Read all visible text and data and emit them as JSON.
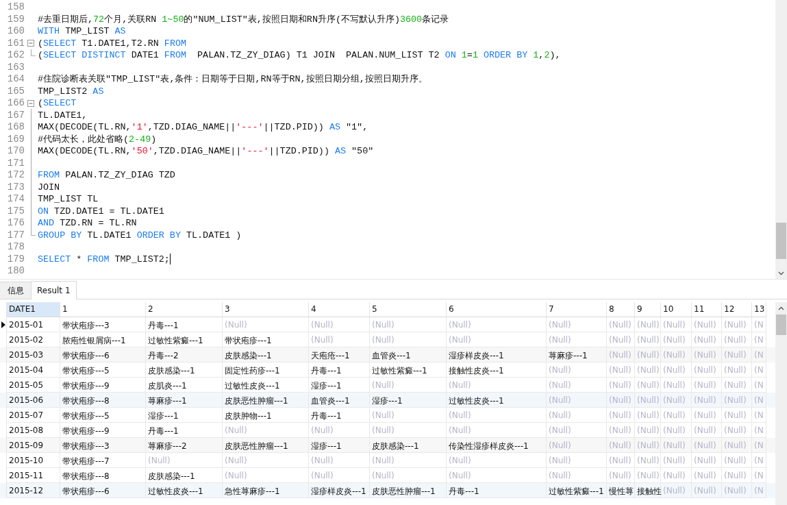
{
  "editor": {
    "lines": [
      {
        "number": "158",
        "kind": "plain",
        "cursor": false
      },
      {
        "number": "159",
        "kind": "plain",
        "cursor": false,
        "tokens": [
          {
            "kind": "plain",
            "t": "#去重日期后,"
          },
          {
            "kind": "num",
            "t": "72"
          },
          {
            "kind": "plain",
            "t": "个月,关联RN "
          },
          {
            "kind": "num",
            "t": "1~50"
          },
          {
            "kind": "plain",
            "t": "的\"NUM_LIST\"表,按照日期和RN升序(不写默认升序)"
          },
          {
            "kind": "num",
            "t": "3600"
          },
          {
            "kind": "plain",
            "t": "条记录"
          }
        ]
      },
      {
        "number": "160",
        "kind": "plain",
        "cursor": false,
        "tokens": [
          {
            "kind": "kw",
            "t": "WITH"
          },
          {
            "kind": "plain",
            "t": " TMP_LIST "
          },
          {
            "kind": "kw",
            "t": "AS"
          }
        ]
      },
      {
        "number": "161",
        "kind": "fold-start",
        "cursor": false,
        "tokens": [
          {
            "kind": "plain",
            "t": "("
          },
          {
            "kind": "kw",
            "t": "SELECT"
          },
          {
            "kind": "plain",
            "t": " T1.DATE1,T2.RN "
          },
          {
            "kind": "kw",
            "t": "FROM"
          }
        ]
      },
      {
        "number": "162",
        "kind": "fold-end",
        "cursor": false,
        "tokens": [
          {
            "kind": "plain",
            "t": "("
          },
          {
            "kind": "kw",
            "t": "SELECT DISTINCT"
          },
          {
            "kind": "plain",
            "t": " DATE1 "
          },
          {
            "kind": "kw",
            "t": "FROM"
          },
          {
            "kind": "plain",
            "t": "  PALAN.TZ_ZY_DIAG) T1 JOIN  PALAN.NUM_LIST T2 "
          },
          {
            "kind": "kw",
            "t": "ON "
          },
          {
            "kind": "num",
            "t": "1"
          },
          {
            "kind": "plain",
            "t": "="
          },
          {
            "kind": "num",
            "t": "1"
          },
          {
            "kind": "kw",
            "t": " ORDER BY "
          },
          {
            "kind": "num",
            "t": "1"
          },
          {
            "kind": "plain",
            "t": ","
          },
          {
            "kind": "num",
            "t": "2"
          },
          {
            "kind": "plain",
            "t": "),"
          }
        ]
      },
      {
        "number": "163",
        "kind": "plain",
        "cursor": false
      },
      {
        "number": "164",
        "kind": "plain",
        "cursor": false,
        "tokens": [
          {
            "kind": "plain",
            "t": "#住院诊断表关联\"TMP_LIST\"表,条件：日期等于日期,RN等于RN,按照日期分组,按照日期升序。"
          }
        ]
      },
      {
        "number": "165",
        "kind": "plain",
        "cursor": false,
        "tokens": [
          {
            "kind": "plain",
            "t": "TMP_LIST2 "
          },
          {
            "kind": "kw",
            "t": "AS"
          }
        ]
      },
      {
        "number": "166",
        "kind": "fold-start",
        "cursor": false,
        "tokens": [
          {
            "kind": "plain",
            "t": "("
          },
          {
            "kind": "kw",
            "t": "SELECT"
          }
        ]
      },
      {
        "number": "167",
        "kind": "fold-body",
        "cursor": false,
        "tokens": [
          {
            "kind": "plain",
            "t": "TL.DATE1,"
          }
        ]
      },
      {
        "number": "168",
        "kind": "fold-body",
        "cursor": false,
        "tokens": [
          {
            "kind": "plain",
            "t": "MAX(DECODE(TL.RN,"
          },
          {
            "kind": "str",
            "t": "'1'"
          },
          {
            "kind": "plain",
            "t": ",TZD.DIAG_NAME||"
          },
          {
            "kind": "str",
            "t": "'---'"
          },
          {
            "kind": "plain",
            "t": "||TZD.PID)) "
          },
          {
            "kind": "kw",
            "t": "AS"
          },
          {
            "kind": "plain",
            "t": " \"1\","
          }
        ]
      },
      {
        "number": "169",
        "kind": "fold-body",
        "cursor": false,
        "tokens": [
          {
            "kind": "plain",
            "t": "#代码太长，此处省略("
          },
          {
            "kind": "num",
            "t": "2-49"
          },
          {
            "kind": "plain",
            "t": ")"
          }
        ]
      },
      {
        "number": "170",
        "kind": "fold-body",
        "cursor": false,
        "tokens": [
          {
            "kind": "plain",
            "t": "MAX(DECODE(TL.RN,"
          },
          {
            "kind": "str",
            "t": "'50'"
          },
          {
            "kind": "plain",
            "t": ",TZD.DIAG_NAME||"
          },
          {
            "kind": "str",
            "t": "'---'"
          },
          {
            "kind": "plain",
            "t": "||TZD.PID)) "
          },
          {
            "kind": "kw",
            "t": "AS"
          },
          {
            "kind": "plain",
            "t": " \"50\""
          }
        ]
      },
      {
        "number": "171",
        "kind": "fold-body",
        "cursor": false
      },
      {
        "number": "172",
        "kind": "fold-body",
        "cursor": false,
        "tokens": [
          {
            "kind": "kw",
            "t": "FROM"
          },
          {
            "kind": "plain",
            "t": " PALAN.TZ_ZY_DIAG TZD"
          }
        ]
      },
      {
        "number": "173",
        "kind": "fold-body",
        "cursor": false,
        "tokens": [
          {
            "kind": "plain",
            "t": "JOIN"
          }
        ]
      },
      {
        "number": "174",
        "kind": "fold-body",
        "cursor": false,
        "tokens": [
          {
            "kind": "plain",
            "t": "TMP_LIST TL"
          }
        ]
      },
      {
        "number": "175",
        "kind": "fold-body",
        "cursor": false,
        "tokens": [
          {
            "kind": "kw",
            "t": "ON"
          },
          {
            "kind": "plain",
            "t": " TZD.DATE1 = TL.DATE1"
          }
        ]
      },
      {
        "number": "176",
        "kind": "fold-body",
        "cursor": false,
        "tokens": [
          {
            "kind": "kw",
            "t": "AND"
          },
          {
            "kind": "plain",
            "t": " TZD.RN = TL.RN"
          }
        ]
      },
      {
        "number": "177",
        "kind": "fold-end",
        "cursor": false,
        "tokens": [
          {
            "kind": "kw",
            "t": "GROUP BY"
          },
          {
            "kind": "plain",
            "t": " TL.DATE1 "
          },
          {
            "kind": "kw",
            "t": "ORDER BY"
          },
          {
            "kind": "plain",
            "t": " TL.DATE1 )"
          }
        ]
      },
      {
        "number": "178",
        "kind": "plain",
        "cursor": false
      },
      {
        "number": "179",
        "kind": "plain",
        "cursor": true,
        "tokens": [
          {
            "kind": "kw",
            "t": "SELECT"
          },
          {
            "kind": "plain",
            "t": " * "
          },
          {
            "kind": "kw",
            "t": "FROM"
          },
          {
            "kind": "plain",
            "t": " TMP_LIST2;"
          }
        ]
      },
      {
        "number": "180",
        "kind": "plain",
        "cursor": false
      }
    ]
  },
  "tabs": [
    {
      "label": "信息",
      "selected": false
    },
    {
      "label": "Result 1",
      "selected": true
    }
  ],
  "table": {
    "columns": [
      {
        "label": "DATE1",
        "selected": true
      },
      {
        "label": "1",
        "selected": false
      },
      {
        "label": "2",
        "selected": false
      },
      {
        "label": "3",
        "selected": false
      },
      {
        "label": "4",
        "selected": false
      },
      {
        "label": "5",
        "selected": false
      },
      {
        "label": "6",
        "selected": false
      },
      {
        "label": "7",
        "selected": false
      },
      {
        "label": "8",
        "selected": false
      },
      {
        "label": "9",
        "selected": false
      },
      {
        "label": "10",
        "selected": false
      },
      {
        "label": "11",
        "selected": false
      },
      {
        "label": "12",
        "selected": false
      },
      {
        "label": "13",
        "selected": false
      }
    ],
    "rows": [
      {
        "selected": true,
        "cells": [
          "2015-01",
          "带状疱疹---3",
          "丹毒---1",
          "(Null)",
          "(Null)",
          "(Null)",
          "(Null)",
          "(Null)",
          "(Null)",
          "(Null)",
          "(Null)",
          "(Null)",
          "(Null)",
          "(N"
        ],
        "null": [
          false,
          false,
          false,
          true,
          true,
          true,
          true,
          true,
          true,
          true,
          true,
          true,
          true,
          true
        ]
      },
      {
        "selected": false,
        "cells": [
          "2015-02",
          "脓疱性银屑病---1",
          "过敏性紫癜---1",
          "带状疱疹---1",
          "(Null)",
          "(Null)",
          "(Null)",
          "(Null)",
          "(Null)",
          "(Null)",
          "(Null)",
          "(Null)",
          "(Null)",
          "(N"
        ],
        "null": [
          false,
          false,
          false,
          false,
          true,
          true,
          true,
          true,
          true,
          true,
          true,
          true,
          true,
          true
        ]
      },
      {
        "selected": false,
        "cells": [
          "2015-03",
          "带状疱疹---6",
          "丹毒---2",
          "皮肤感染---1",
          "天疱疮---1",
          "血管炎---1",
          "湿疹样皮炎---1",
          "荨麻疹---1",
          "(Null)",
          "(Null)",
          "(Null)",
          "(Null)",
          "(Null)",
          "(N"
        ],
        "null": [
          false,
          false,
          false,
          false,
          false,
          false,
          false,
          false,
          true,
          true,
          true,
          true,
          true,
          true
        ]
      },
      {
        "selected": false,
        "cells": [
          "2015-04",
          "带状疱疹---5",
          "皮肤感染---1",
          "固定性药疹---1",
          "丹毒---1",
          "过敏性紫癜---1",
          "接触性皮炎---1",
          "(Null)",
          "(Null)",
          "(Null)",
          "(Null)",
          "(Null)",
          "(Null)",
          "(N"
        ],
        "null": [
          false,
          false,
          false,
          false,
          false,
          false,
          false,
          true,
          true,
          true,
          true,
          true,
          true,
          true
        ]
      },
      {
        "selected": false,
        "cells": [
          "2015-05",
          "带状疱疹---9",
          "皮肌炎---1",
          "过敏性皮炎---1",
          "湿疹---1",
          "(Null)",
          "(Null)",
          "(Null)",
          "(Null)",
          "(Null)",
          "(Null)",
          "(Null)",
          "(Null)",
          "(N"
        ],
        "null": [
          false,
          false,
          false,
          false,
          false,
          true,
          true,
          true,
          true,
          true,
          true,
          true,
          true,
          true
        ]
      },
      {
        "selected": false,
        "cells": [
          "2015-06",
          "带状疱疹---8",
          "荨麻疹---1",
          "皮肤恶性肿瘤---1",
          "血管炎---1",
          "湿疹---1",
          "过敏性皮炎---1",
          "(Null)",
          "(Null)",
          "(Null)",
          "(Null)",
          "(Null)",
          "(Null)",
          "(N"
        ],
        "null": [
          false,
          false,
          false,
          false,
          false,
          false,
          false,
          true,
          true,
          true,
          true,
          true,
          true,
          true
        ]
      },
      {
        "selected": false,
        "cells": [
          "2015-07",
          "带状疱疹---5",
          "湿疹---1",
          "皮肤肿物---1",
          "丹毒---1",
          "(Null)",
          "(Null)",
          "(Null)",
          "(Null)",
          "(Null)",
          "(Null)",
          "(Null)",
          "(Null)",
          "(N"
        ],
        "null": [
          false,
          false,
          false,
          false,
          false,
          true,
          true,
          true,
          true,
          true,
          true,
          true,
          true,
          true
        ]
      },
      {
        "selected": false,
        "cells": [
          "2015-08",
          "带状疱疹---9",
          "丹毒---1",
          "(Null)",
          "(Null)",
          "(Null)",
          "(Null)",
          "(Null)",
          "(Null)",
          "(Null)",
          "(Null)",
          "(Null)",
          "(Null)",
          "(N"
        ],
        "null": [
          false,
          false,
          false,
          true,
          true,
          true,
          true,
          true,
          true,
          true,
          true,
          true,
          true,
          true
        ]
      },
      {
        "selected": false,
        "cells": [
          "2015-09",
          "带状疱疹---3",
          "荨麻疹---2",
          "皮肤恶性肿瘤---1",
          "湿疹---1",
          "皮肤感染---1",
          "传染性湿疹样皮炎---1",
          "(Null)",
          "(Null)",
          "(Null)",
          "(Null)",
          "(Null)",
          "(Null)",
          "(N"
        ],
        "null": [
          false,
          false,
          false,
          false,
          false,
          false,
          false,
          true,
          true,
          true,
          true,
          true,
          true,
          true
        ]
      },
      {
        "selected": false,
        "cells": [
          "2015-10",
          "带状疱疹---7",
          "(Null)",
          "(Null)",
          "(Null)",
          "(Null)",
          "(Null)",
          "(Null)",
          "(Null)",
          "(Null)",
          "(Null)",
          "(Null)",
          "(Null)",
          "(N"
        ],
        "null": [
          false,
          false,
          true,
          true,
          true,
          true,
          true,
          true,
          true,
          true,
          true,
          true,
          true,
          true
        ]
      },
      {
        "selected": false,
        "cells": [
          "2015-11",
          "带状疱疹---8",
          "皮肤感染---1",
          "(Null)",
          "(Null)",
          "(Null)",
          "(Null)",
          "(Null)",
          "(Null)",
          "(Null)",
          "(Null)",
          "(Null)",
          "(Null)",
          "(N"
        ],
        "null": [
          false,
          false,
          false,
          true,
          true,
          true,
          true,
          true,
          true,
          true,
          true,
          true,
          true,
          true
        ]
      },
      {
        "selected": false,
        "cells": [
          "2015-12",
          "带状疱疹---6",
          "过敏性皮炎---1",
          "急性荨麻疹---1",
          "湿疹样皮炎---1",
          "皮肤恶性肿瘤---1",
          "丹毒---1",
          "过敏性紫癜---1",
          "慢性荨",
          "接触性",
          "(Null)",
          "(Null)",
          "(Null)",
          "(N"
        ],
        "null": [
          false,
          false,
          false,
          false,
          false,
          false,
          false,
          false,
          false,
          false,
          true,
          true,
          true,
          true
        ]
      }
    ]
  }
}
